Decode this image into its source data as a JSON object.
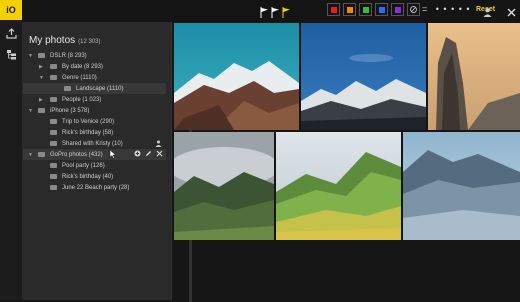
{
  "app": {
    "logo_text": "iO",
    "brand_color": "#f4d000"
  },
  "topbar": {
    "flags": [
      "flag-icon",
      "flag-icon",
      "flag-icon"
    ],
    "flag_colors": [
      "#ffffff",
      "#ffffff",
      "#f4d000"
    ],
    "color_labels": [
      {
        "name": "red",
        "color": "#e02020"
      },
      {
        "name": "orange",
        "color": "#f08a00"
      },
      {
        "name": "green",
        "color": "#2fbf3a"
      },
      {
        "name": "blue",
        "color": "#2a6bff"
      },
      {
        "name": "purple",
        "color": "#8a2be2"
      }
    ],
    "rating_prefix": "=",
    "rating_dots": "• • • • •",
    "reset_label": "Reset"
  },
  "panel": {
    "title": "My photos",
    "count": "(12 303)",
    "tree": [
      {
        "label": "DSLR (8 293)",
        "level": 0,
        "expanded": true
      },
      {
        "label": "By date (8 293)",
        "level": 1,
        "expanded": false
      },
      {
        "label": "Genre (1110)",
        "level": 1,
        "expanded": true
      },
      {
        "label": "Landscape (1110)",
        "level": 2,
        "expanded": false,
        "selected": true
      },
      {
        "label": "People (1 023)",
        "level": 1,
        "expanded": false
      },
      {
        "label": "iPhone (3 578)",
        "level": 0,
        "expanded": true
      },
      {
        "label": "Trip to Venice (290)",
        "level": 1,
        "expanded": false
      },
      {
        "label": "Rick's birthday (58)",
        "level": 1,
        "expanded": false
      },
      {
        "label": "Shared with Kristy (10)",
        "level": 1,
        "expanded": false,
        "shared": true
      },
      {
        "label": "GoPro photos (432)",
        "level": 0,
        "expanded": true,
        "hover": true
      },
      {
        "label": "Pool party (126)",
        "level": 1,
        "expanded": false
      },
      {
        "label": "Rick's birthday (40)",
        "level": 1,
        "expanded": false
      },
      {
        "label": "June 22 Beach party (28)",
        "level": 1,
        "expanded": false
      }
    ]
  }
}
